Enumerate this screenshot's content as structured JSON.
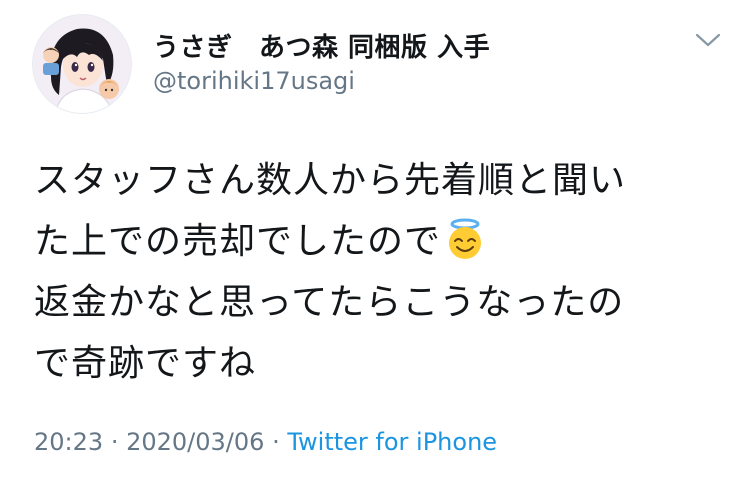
{
  "tweet": {
    "author": {
      "display_name": "うさぎ　あつ森 同梱版 入手",
      "handle": "@torihiki17usagi",
      "avatar_icon": "anime-avatar"
    },
    "menu_icon": "chevron-down-icon",
    "text_lines": [
      "スタッフさん数人から先着順と聞い",
      "た上での売却でしたので",
      "返金かなと思ってたらこうなったの",
      "で奇跡ですね"
    ],
    "emoji": "😇",
    "time": "20:23",
    "separator": "·",
    "date": "2020/03/06",
    "source": "Twitter for iPhone"
  },
  "colors": {
    "text": "#14171a",
    "secondary": "#657786",
    "link": "#1b95e0"
  }
}
